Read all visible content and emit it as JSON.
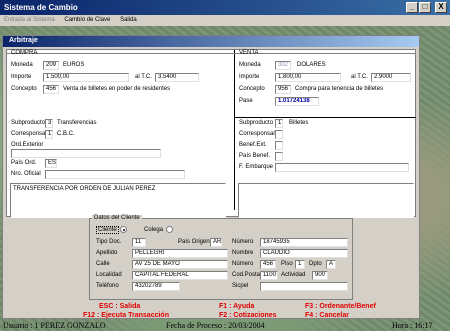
{
  "window": {
    "title": "Sistema de Cambio",
    "min": "_",
    "max": "□",
    "close": "X"
  },
  "menu": [
    "Entrada al Sistema",
    "Cambio de Clave",
    "Salida"
  ],
  "dialog": {
    "title": "Arbitraje"
  },
  "compra": {
    "header": "COMPRA",
    "moneda_label": "Moneda",
    "moneda_code": "209",
    "moneda_name": "EUROS",
    "importe_label": "Importe",
    "importe": "1.500,00",
    "tc_label": "al T.C.",
    "tc": "3.5400",
    "concepto_label": "Concepto",
    "concepto_code": "456",
    "concepto_desc": "Venta de billetes en poder de residentes"
  },
  "venta": {
    "header": "VENTA",
    "moneda_label": "Moneda",
    "moneda_code": "302",
    "moneda_name": "DOLARES",
    "importe_label": "Importe",
    "importe": "1.800,00",
    "tc_label": "al T.C.",
    "tc": "2.9000",
    "concepto_label": "Concepto",
    "concepto_code": "956",
    "concepto_desc": "Compra para tenencia de billetes",
    "pase_label": "Pase",
    "pase": "1.01724138"
  },
  "compra_detail": {
    "subproducto_label": "Subproducto",
    "subproducto_code": "3",
    "subproducto_name": "Transferencias",
    "corresponsal_label": "Corresponsal",
    "corresponsal_code": "1",
    "corresponsal_name": "C.B.C.",
    "ord_exterior_label": "Ord.Exterior",
    "ord_exterior": "",
    "pais_ord_label": "País Ord.",
    "pais_ord": "ES",
    "nro_oficial_label": "Nro. Oficial",
    "nro_oficial": "",
    "memo": "TRANSFERENCIA POR ORDEN DE JULIAN PEREZ"
  },
  "venta_detail": {
    "subproducto_label": "Subproducto",
    "subproducto_code": "1",
    "subproducto_name": "Billetes",
    "corresponsal_label": "Corresponsal",
    "benef_ext_label": "Benef.Ext.",
    "pais_benef_label": "País Benef.",
    "f_embarque_label": "F. Embarque"
  },
  "cliente": {
    "box_title": "Datos del Cliente",
    "radio_cliente": "Cliente",
    "radio_colega": "Colega",
    "tipo_doc_label": "Tipo Doc.",
    "tipo_doc": "11",
    "pais_origen_label": "País Origen",
    "pais_origen": "AR",
    "numero_label": "Número",
    "numero": "18745935",
    "apellido_label": "Apellido",
    "apellido": "PELLEGRI",
    "nombre_label": "Nombre",
    "nombre": "CLAUDIO",
    "calle_label": "Calle",
    "calle": "AV 25 DE MAYO",
    "numero2_label": "Número",
    "numero2": "456",
    "piso_label": "Piso",
    "piso": "1",
    "dpto_label": "Dpto",
    "dpto": "A",
    "localidad_label": "Localidad",
    "localidad": "CAPITAL FEDERAL",
    "cod_postal_label": "Cod.Postal",
    "cod_postal": "1100",
    "actividad_label": "Actividad",
    "actividad": "900",
    "telefono_label": "Teléfono",
    "telefono": "43202789",
    "sicpel_label": "Sicpel"
  },
  "fkeys": {
    "esc": "ESC : Salida",
    "f1": "F1 : Ayuda",
    "f3": "F3 : Ordenante/Benef",
    "f12": "F12 : Ejecuta Transacción",
    "f2": "F2 : Cotizaciones",
    "f4": "F4 : Cancelar"
  },
  "status": {
    "usuario": "Usuario : 1  PEREZ GONZALO",
    "fecha": "Fecha de Proceso : 20/03/2004",
    "hora": "Hora : 16:17"
  }
}
